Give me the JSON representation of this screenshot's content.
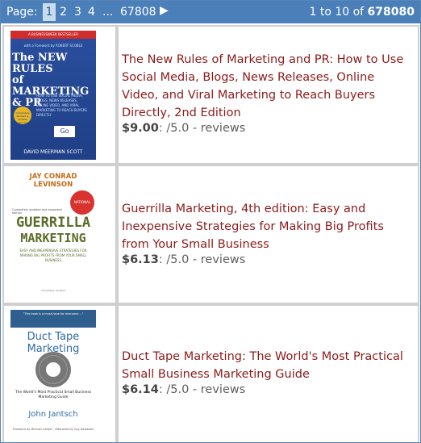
{
  "pager": {
    "label": "Page:",
    "current_page": "1",
    "pages": [
      "2",
      "3",
      "4"
    ],
    "ellipsis": "...",
    "last_page": "67808",
    "next_icon": "▶",
    "range_text": "1 to 10 of",
    "total": "678080"
  },
  "products": [
    {
      "title": "The New Rules of Marketing and PR: How to Use Social Media, Blogs, News Releases, Online Video, and Viral Marketing to Reach Buyers Directly, 2nd Edition",
      "price": "$9.00",
      "rating_text": ": /5.0 -",
      "reviews_label": "reviews",
      "cover": {
        "top_tag": "A BUSINESSWEEK BESTSELLER",
        "foreword": "with a Foreword by ROBERT SCOBLE",
        "title_lines": [
          "The NEW RULES",
          "of MARKETING",
          "& PR"
        ],
        "blurb": "HOW TO USE SOCIAL MEDIA, BLOGS, NEWS RELEASES, ONLINE VIDEO, AND VIRAL MARKETING TO REACH BUYERS DIRECTLY",
        "seal": "Completely Revised & Updated Second Edition",
        "go": "Go",
        "author": "DAVID MEERMAN SCOTT"
      }
    },
    {
      "title": "Guerrilla Marketing, 4th edition: Easy and Inexpensive Strategies for Making Big Profits from Your Small Business",
      "price": "$6.13",
      "rating_text": ": /5.0 -",
      "reviews_label": "reviews",
      "cover": {
        "author": "JAY CONRAD LEVINSON",
        "badge": "NATIONAL BESTSELLER",
        "edition_note": "Completely updated and expanded edition",
        "title_line1": "GUERRILLA",
        "title_line2": "MARKETING",
        "subtitle": "EASY AND INEXPENSIVE STRATEGIES FOR MAKING BIG PROFITS FROM YOUR SMALL BUSINESS",
        "bottom_note": "Completely Updated"
      }
    },
    {
      "title": "Duct Tape Marketing: The World's Most Practical Small Business Marketing Guide",
      "price": "$6.14",
      "rating_text": ": /5.0 -",
      "reviews_label": "reviews",
      "cover": {
        "band_text": "\"This book is a must-have for everyone ...\"",
        "title": "Duct Tape Marketing",
        "subtitle": "The World's Most Practical Small Business Marketing Guide",
        "author": "John Jantsch",
        "foreword": "Foreword by Michael Gerber · Afterword by Guy Kawasaki"
      }
    }
  ]
}
